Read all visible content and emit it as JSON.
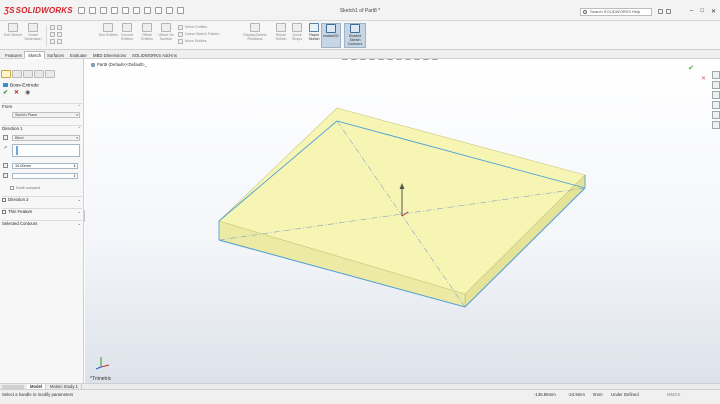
{
  "app": {
    "brand": "SOLIDWORKS",
    "document_title": "Sketch1 of Part8 *"
  },
  "help_search": {
    "placeholder": "Search SOLIDWORKS Help"
  },
  "ribbon": {
    "exit_sketch": "Exit Sketch",
    "smart_dimension": "Smart Dimension",
    "trim_entities": "Trim Entities",
    "convert_entities": "Convert Entities",
    "offset_entities": "Offset Entities",
    "offset_on_surface": "Offset On Surface",
    "mirror_entities": "Mirror Entities",
    "linear_sketch_pattern": "Linear Sketch Pattern",
    "move_entities": "Move Entities",
    "display_delete_relations": "Display/Delete Relations",
    "repair_sketch": "Repair Sketch",
    "quick_snaps": "Quick Snaps",
    "rapid_sketch": "Rapid Sketch",
    "instant2d": "Instant2D",
    "shaded_sketch_contours": "Shaded Sketch Contours"
  },
  "tabs": [
    "Features",
    "Sketch",
    "Surfaces",
    "Evaluate",
    "MBD Dimensions",
    "SOLIDWORKS Add-Ins"
  ],
  "active_tab": "Sketch",
  "property_manager": {
    "title": "Boss-Extrude",
    "from_label": "From",
    "from_value": "Sketch Plane",
    "direction1_label": "Direction 1",
    "end_condition": "Blind",
    "depth": "10.00mm",
    "draft_outward": "Draft outward",
    "direction2_label": "Direction 2",
    "thin_feature_label": "Thin Feature",
    "selected_contours_label": "Selected Contours"
  },
  "viewport": {
    "tree_path": "Part8 (Default<<Default>_",
    "view_orientation": "*Trimetric"
  },
  "bottom_tabs": [
    "Model",
    "Motion Study 1"
  ],
  "active_bottom_tab": "Model",
  "status": {
    "message": "Select a handle to modify parameters",
    "x": "-135.96mm",
    "y": "-24.9mm",
    "z": "0mm",
    "sketch_state": "Under Defined",
    "units": "MMGS"
  },
  "colors": {
    "extrude_preview": "#f6f5b4",
    "sketch_line": "#4a9fd8",
    "brand_red": "#d8232a"
  }
}
